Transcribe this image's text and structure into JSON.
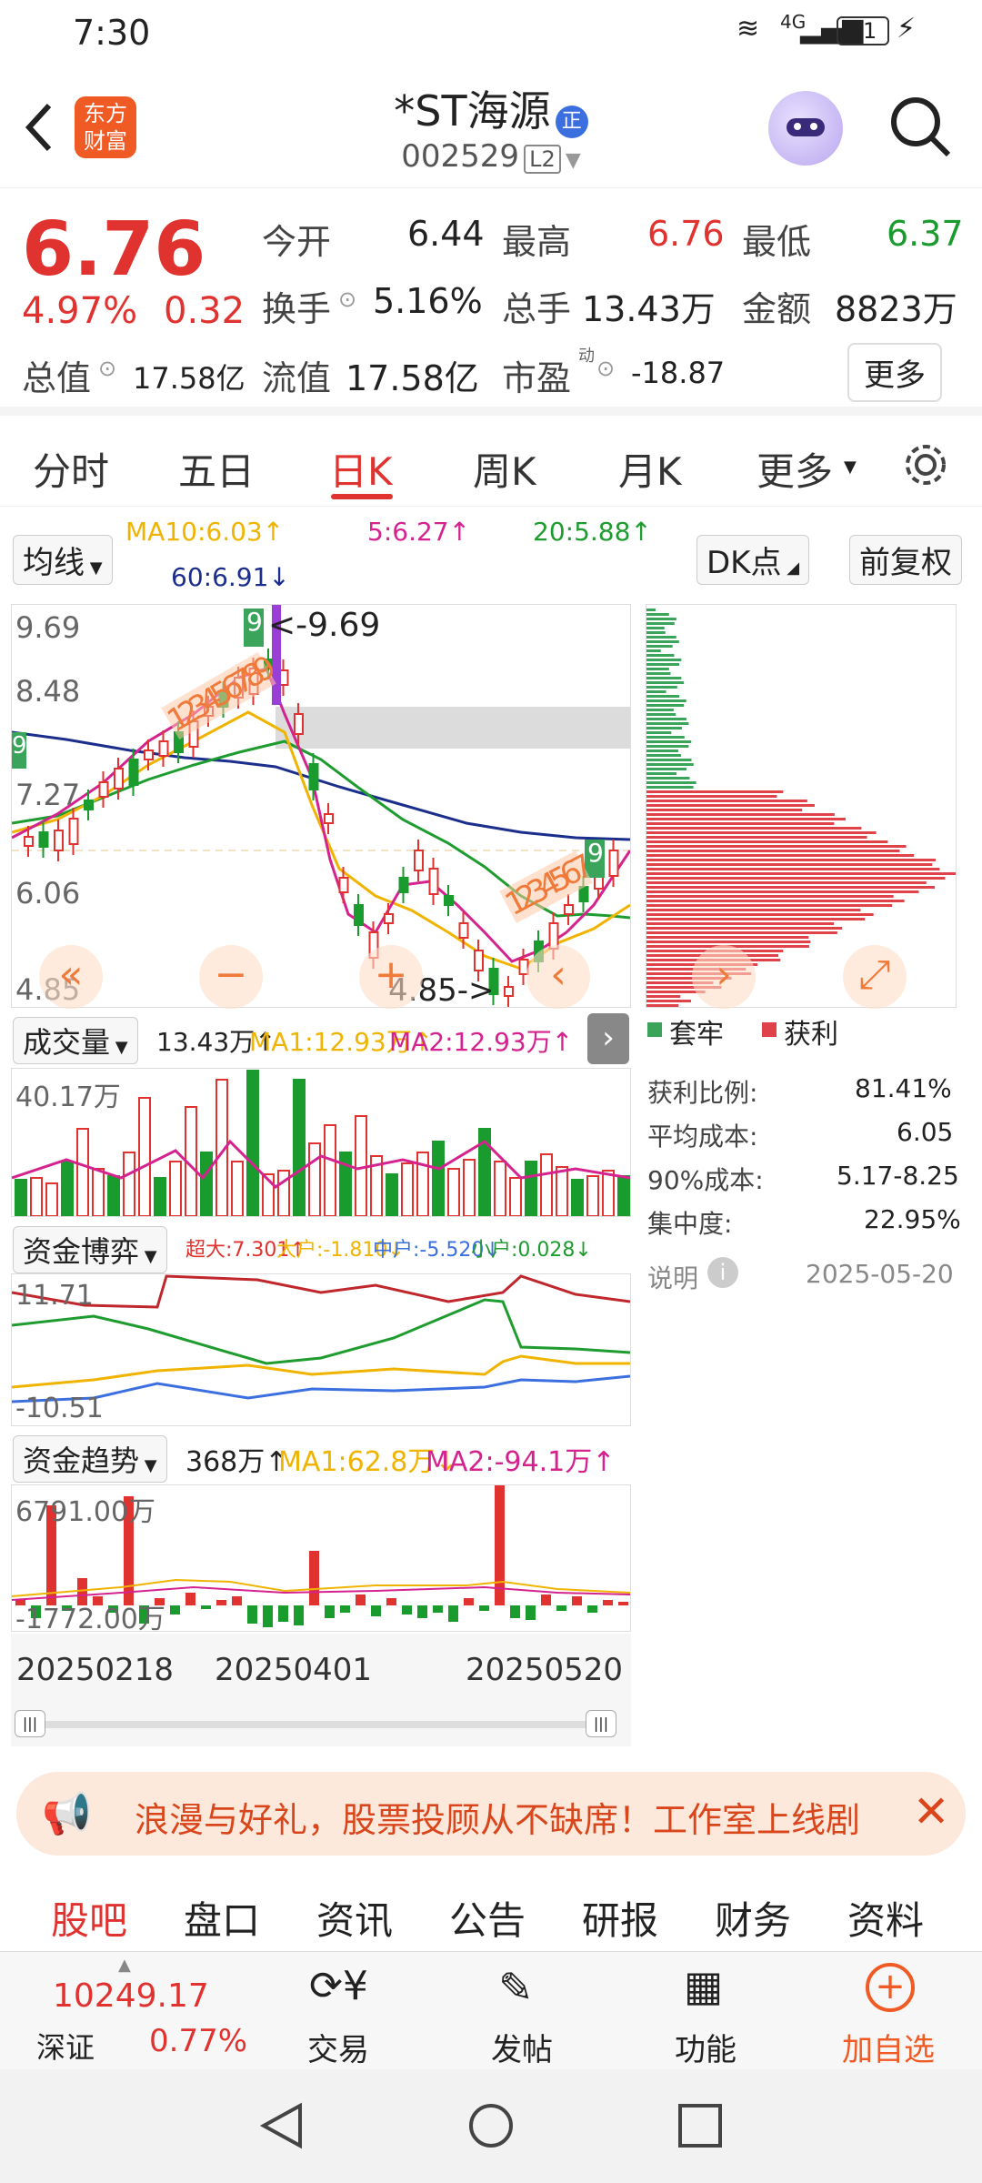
{
  "status": {
    "time": "7:30",
    "network": "4G",
    "battery": "31"
  },
  "header": {
    "logo_line1": "东方",
    "logo_line2": "财富",
    "title": "*ST海源",
    "badge": "正",
    "code": "002529",
    "level": "L2"
  },
  "quote": {
    "price": "6.76",
    "pct": "4.97%",
    "chg": "0.32",
    "open_label": "今开",
    "open": "6.44",
    "high_label": "最高",
    "high": "6.76",
    "low_label": "最低",
    "low": "6.37",
    "turnover_label": "换手",
    "turnover": "5.16%",
    "vol_label": "总手",
    "vol": "13.43万",
    "amt_label": "金额",
    "amt": "8823万",
    "mcap_label": "总值",
    "mcap": "17.58亿",
    "float_label": "流值",
    "float": "17.58亿",
    "pe_label": "市盈",
    "pe_sup": "动",
    "pe": "-18.87",
    "more": "更多"
  },
  "tabs": [
    "分时",
    "五日",
    "日K",
    "周K",
    "月K",
    "更多"
  ],
  "ma_bar": {
    "selector": "均线",
    "ma10": "MA10:6.03↑",
    "ma5": "5:6.27↑",
    "ma20": "20:5.88↑",
    "ma60": "60:6.91↓",
    "dk": "DK点",
    "fq": "前复权"
  },
  "kline": {
    "y_labels": [
      "9.69",
      "8.48",
      "7.27",
      "6.06",
      "4.85"
    ],
    "high_note": "<-9.69",
    "low_note": "4.85->",
    "seq_top": "123456789",
    "seq_bottom": "1234567",
    "tag9": "9"
  },
  "chips": {
    "legend_trapped": "套牢",
    "legend_profit": "获利",
    "profit_ratio_label": "获利比例:",
    "profit_ratio": "81.41%",
    "avg_cost_label": "平均成本:",
    "avg_cost": "6.05",
    "cost90_label": "90%成本:",
    "cost90": "5.17-8.25",
    "concentration_label": "集中度:",
    "concentration": "22.95%",
    "note_label": "说明",
    "date": "2025-05-20"
  },
  "volume": {
    "selector": "成交量",
    "value": "13.43万↑",
    "ma1": "MA1:12.93万↑",
    "ma2": "MA2:12.93万↑",
    "max_label": "40.17万"
  },
  "capital_game": {
    "selector": "资金博弈",
    "super": "超大:7.301↑",
    "big": "大户:-1.810↓",
    "mid": "中户:-5.520↓",
    "small": "小户:0.028↓",
    "top": "11.71",
    "bottom": "-10.51"
  },
  "capital_trend": {
    "selector": "资金趋势",
    "value": "368万↑",
    "ma1": "MA1:62.8万↓",
    "ma2": "MA2:-94.1万↑",
    "top": "6791.00万",
    "bottom": "-1772.00万"
  },
  "dates": [
    "20250218",
    "20250401",
    "20250520"
  ],
  "banner": {
    "text": "浪漫与好礼，股票投顾从不缺席！工作室上线剧"
  },
  "subtabs": [
    "股吧",
    "盘口",
    "资讯",
    "公告",
    "研报",
    "财务",
    "资料"
  ],
  "bottom": {
    "index_value": "10249.17",
    "index_name": "深证",
    "index_pct": "0.77%",
    "trade": "交易",
    "post": "发帖",
    "func": "功能",
    "add": "加自选"
  },
  "colors": {
    "red": "#e0322e",
    "green": "#1a9b2d",
    "orange": "#f07a3a",
    "ma5": "#d4238f",
    "ma10": "#f0b400",
    "ma20": "#1f9c2f",
    "ma60": "#1b2e8c"
  }
}
